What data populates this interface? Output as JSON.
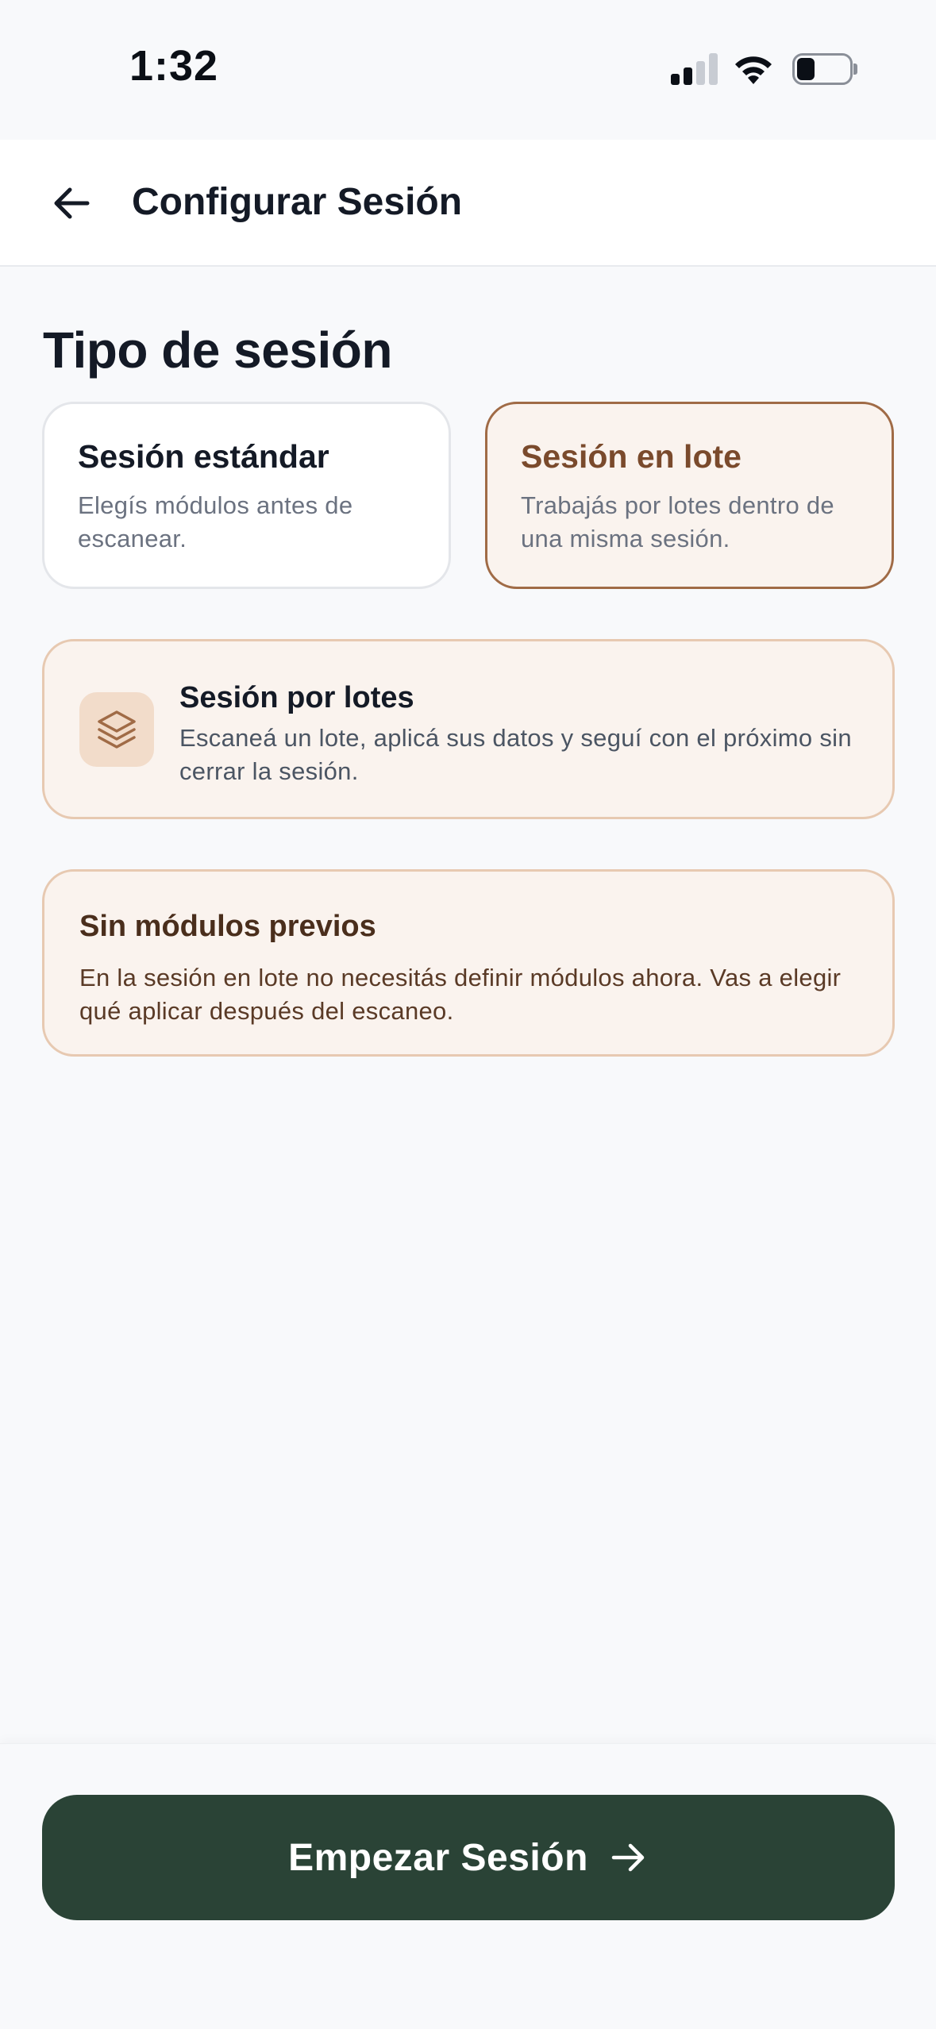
{
  "status_bar": {
    "time": "1:32",
    "signal_bars_active": 2,
    "signal_bars_total": 4,
    "battery_level": 0.3
  },
  "header": {
    "title": "Configurar Sesión",
    "back_icon": "arrow-left-icon"
  },
  "session_type": {
    "title": "Tipo de sesión",
    "options": [
      {
        "title": "Sesión estándar",
        "description": "Elegís módulos antes de escanear.",
        "selected": false
      },
      {
        "title": "Sesión en lote",
        "description": "Trabajás por lotes dentro de una misma sesión.",
        "selected": true
      }
    ]
  },
  "info_card": {
    "icon": "layers-icon",
    "title": "Sesión por lotes",
    "description": "Escaneá un lote, aplicá sus datos y seguí con el próximo sin cerrar la sesión."
  },
  "note_card": {
    "title": "Sin módulos previos",
    "description": "En la sesión en lote no necesitás definir módulos ahora. Vas a elegir qué aplicar después del escaneo."
  },
  "footer": {
    "start_label": "Empezar Sesión",
    "start_icon": "arrow-right-icon"
  },
  "colors": {
    "accent_brown": "#a06b46",
    "primary_green": "#2a4336",
    "card_tint": "#faf3ee"
  }
}
